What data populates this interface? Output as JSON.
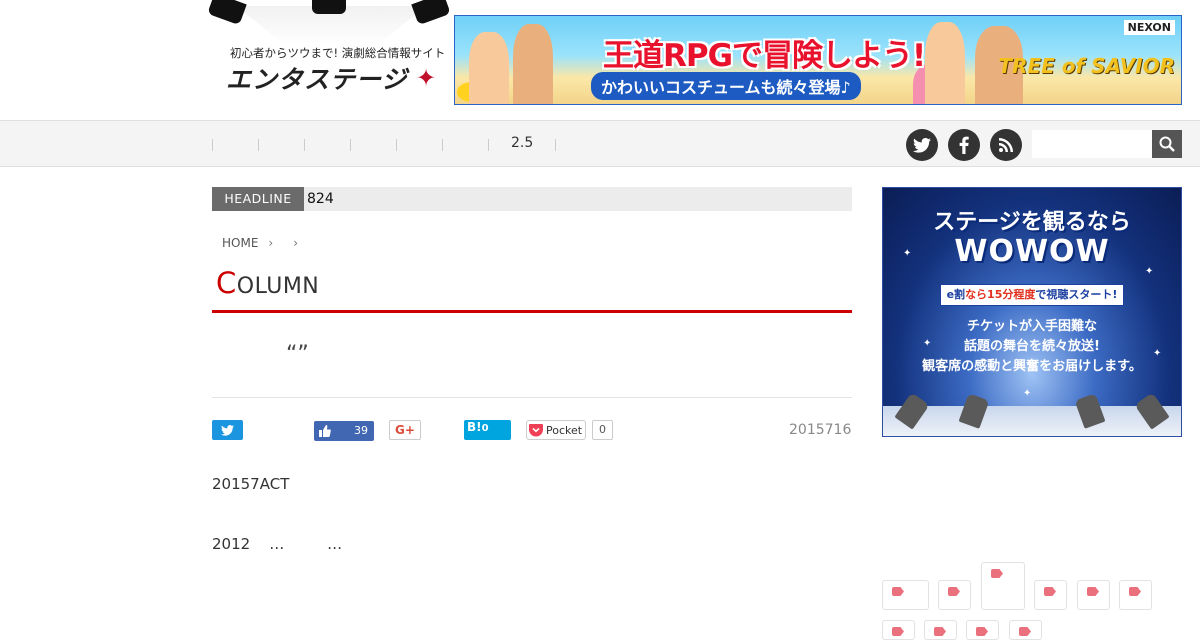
{
  "header": {
    "logo_tagline": "初心者からツウまで! 演劇総合情報サイト",
    "logo_title": "エンタステージ",
    "banner": {
      "headline": "王道RPGで冒険しよう!",
      "sub": "かわいいコスチュームも続々登場♪",
      "brand": "NEXON",
      "game": "TREE of SAVIOR"
    }
  },
  "nav": {
    "item_25": "2.5",
    "search_placeholder": ""
  },
  "headline": {
    "label": "HEADLINE",
    "text": "824"
  },
  "breadcrumb": {
    "home": "HOME"
  },
  "column": {
    "first_letter": "C",
    "rest": "OLUMN"
  },
  "article": {
    "title": "“”",
    "date": "2015716",
    "body_p1": "20157ACT",
    "body_p2": "2012    …         …"
  },
  "share": {
    "fb_like_count": "39",
    "gplus_label": "G+",
    "hatena_label": "B!",
    "hatena_count": "0",
    "pocket_label": "Pocket",
    "pocket_count": "0"
  },
  "sidebar_ad": {
    "line1": "ステージを観るなら",
    "line2": "WOWOW",
    "badge_pre": "e割",
    "badge_hl": "なら15分程度",
    "badge_post": "で視聴スタート!",
    "msg1": "チケットが入手困難な",
    "msg2": "話題の舞台を続々放送!",
    "msg3": "観客席の感動と興奮をお届けします。"
  },
  "colors": {
    "accent_red": "#cc0000",
    "twitter": "#1b95e0",
    "facebook": "#4267b2",
    "hatena": "#00a4de",
    "tag_icon": "#e9707c"
  }
}
